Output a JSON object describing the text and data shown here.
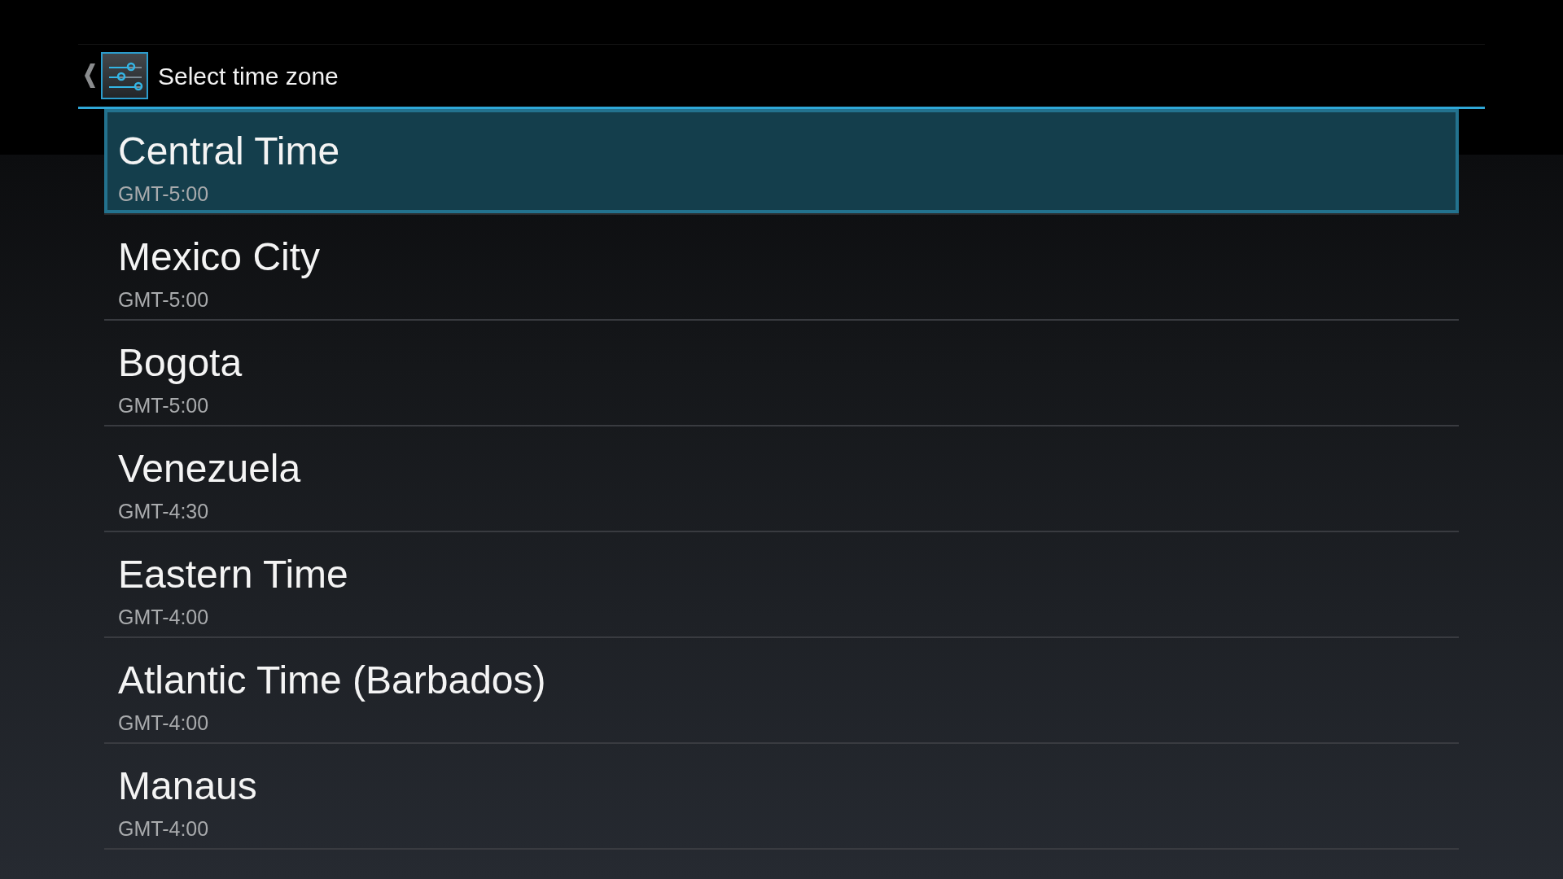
{
  "action_bar": {
    "title": "Select time zone"
  },
  "time_zones": [
    {
      "name": "Central Time",
      "offset": "GMT-5:00",
      "selected": true
    },
    {
      "name": "Mexico City",
      "offset": "GMT-5:00",
      "selected": false
    },
    {
      "name": "Bogota",
      "offset": "GMT-5:00",
      "selected": false
    },
    {
      "name": "Venezuela",
      "offset": "GMT-4:30",
      "selected": false
    },
    {
      "name": "Eastern Time",
      "offset": "GMT-4:00",
      "selected": false
    },
    {
      "name": "Atlantic Time (Barbados)",
      "offset": "GMT-4:00",
      "selected": false
    },
    {
      "name": "Manaus",
      "offset": "GMT-4:00",
      "selected": false
    }
  ]
}
